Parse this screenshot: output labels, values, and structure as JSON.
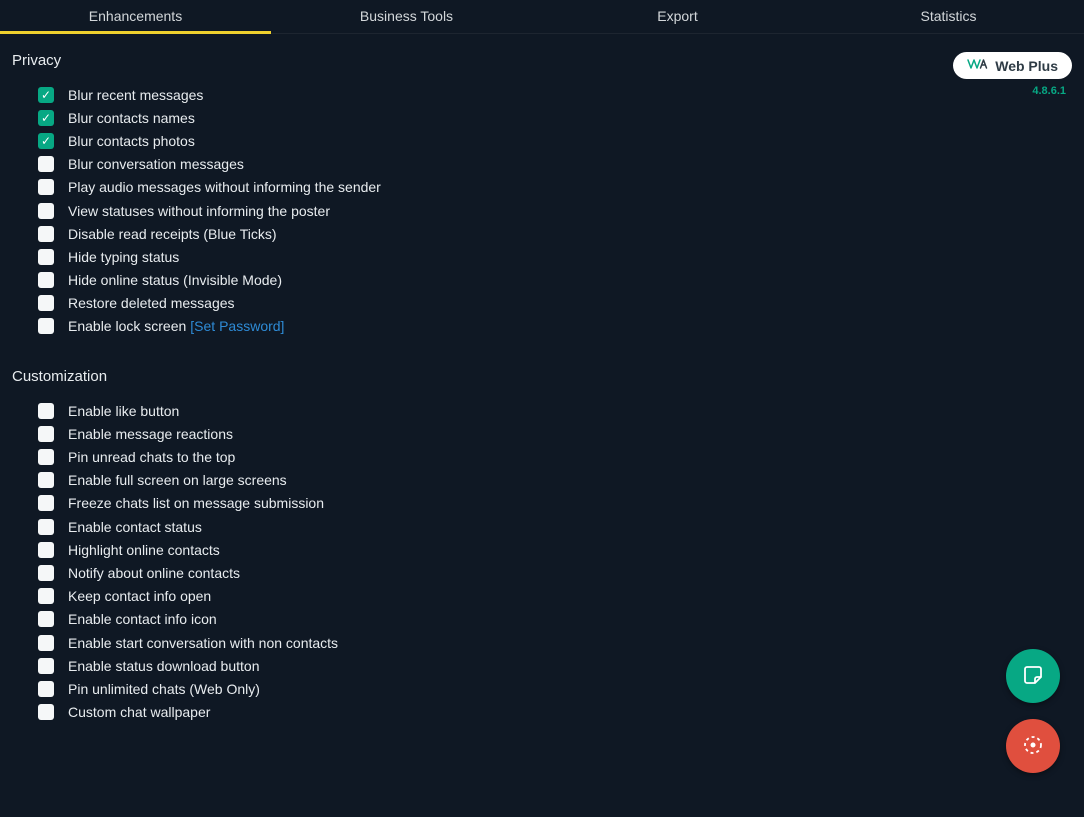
{
  "tabs": [
    {
      "label": "Enhancements",
      "active": true
    },
    {
      "label": "Business Tools",
      "active": false
    },
    {
      "label": "Export",
      "active": false
    },
    {
      "label": "Statistics",
      "active": false
    }
  ],
  "badge": {
    "text": "Web Plus"
  },
  "version": "4.8.6.1",
  "sections": {
    "privacy": {
      "title": "Privacy",
      "items": [
        {
          "label": "Blur recent messages",
          "checked": true
        },
        {
          "label": "Blur contacts names",
          "checked": true
        },
        {
          "label": "Blur contacts photos",
          "checked": true
        },
        {
          "label": "Blur conversation messages",
          "checked": false
        },
        {
          "label": "Play audio messages without informing the sender",
          "checked": false
        },
        {
          "label": "View statuses without informing the poster",
          "checked": false
        },
        {
          "label": "Disable read receipts (Blue Ticks)",
          "checked": false
        },
        {
          "label": "Hide typing status",
          "checked": false
        },
        {
          "label": "Hide online status (Invisible Mode)",
          "checked": false
        },
        {
          "label": "Restore deleted messages",
          "checked": false
        },
        {
          "label": "Enable lock screen",
          "checked": false,
          "link": "[Set Password]"
        }
      ]
    },
    "customization": {
      "title": "Customization",
      "items": [
        {
          "label": "Enable like button",
          "checked": false
        },
        {
          "label": "Enable message reactions",
          "checked": false
        },
        {
          "label": "Pin unread chats to the top",
          "checked": false
        },
        {
          "label": "Enable full screen on large screens",
          "checked": false
        },
        {
          "label": "Freeze chats list on message submission",
          "checked": false
        },
        {
          "label": "Enable contact status",
          "checked": false
        },
        {
          "label": "Highlight online contacts",
          "checked": false
        },
        {
          "label": "Notify about online contacts",
          "checked": false
        },
        {
          "label": "Keep contact info open",
          "checked": false
        },
        {
          "label": "Enable contact info icon",
          "checked": false
        },
        {
          "label": "Enable start conversation with non contacts",
          "checked": false
        },
        {
          "label": "Enable status download button",
          "checked": false
        },
        {
          "label": "Pin unlimited chats (Web Only)",
          "checked": false
        },
        {
          "label": "Custom chat wallpaper",
          "checked": false
        }
      ]
    }
  }
}
